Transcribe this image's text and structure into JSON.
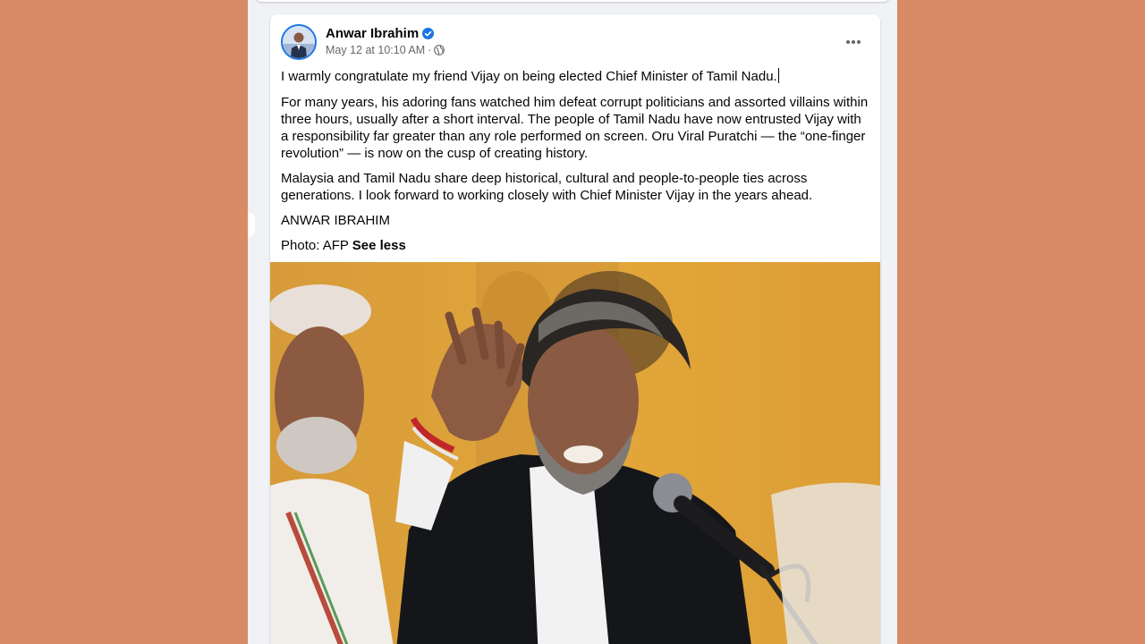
{
  "post": {
    "author_name": "Anwar Ibrahim",
    "timestamp": "May 12 at 10:10 AM",
    "separator": "·",
    "audience_icon": "globe-icon",
    "verified_icon": "verified-badge-icon",
    "more_icon": "more-options-icon",
    "paragraphs": [
      "I warmly congratulate my friend Vijay on being elected Chief Minister of Tamil Nadu.",
      "For many years, his adoring fans watched him defeat corrupt politicians and assorted villains within three hours, usually after a short interval. The people of Tamil Nadu have now entrusted Vijay with a responsibility far greater than any role performed on screen. Oru Viral Puratchi — the “one-finger revolution” — is now on the cusp of creating history.",
      "Malaysia and Tamil Nadu share deep historical, cultural and people-to-people ties across generations. I look forward to working closely with Chief Minister Vijay in the years ahead.",
      "ANWAR IBRAHIM"
    ],
    "photo_credit": "Photo: AFP",
    "see_less_label": "See less"
  },
  "colors": {
    "page_background": "#d98b66",
    "feed_background": "#f0f2f5",
    "verified_blue": "#1b74e4",
    "secondary_text": "#65676b",
    "photo_background": "#e0a233"
  }
}
